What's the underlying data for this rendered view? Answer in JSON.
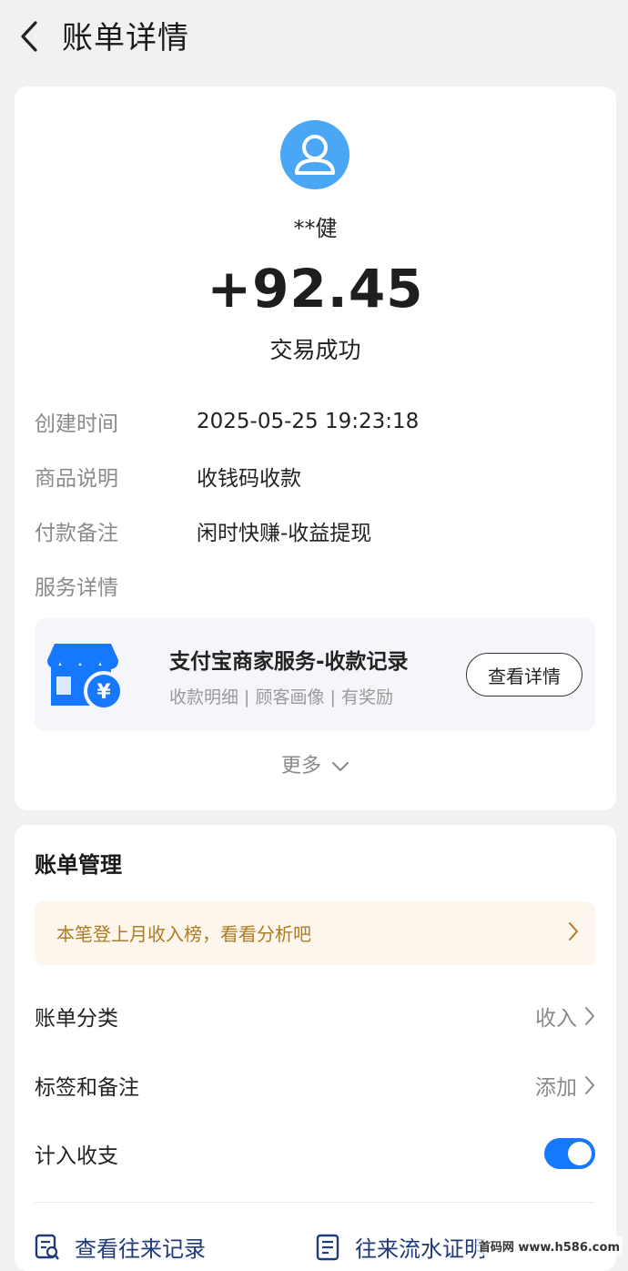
{
  "header": {
    "title": "账单详情",
    "back_icon": "chevron-left-icon"
  },
  "transaction": {
    "payer_name": "**健",
    "amount": "+92.45",
    "status": "交易成功",
    "avatar_color": "#4aa7f5"
  },
  "details": [
    {
      "label": "创建时间",
      "value": "2025-05-25 19:23:18"
    },
    {
      "label": "商品说明",
      "value": "收钱码收款"
    },
    {
      "label": "付款备注",
      "value": "闲时快赚-收益提现"
    },
    {
      "label": "服务详情",
      "value": ""
    }
  ],
  "service": {
    "title": "支付宝商家服务-收款记录",
    "subtitle": "收款明细 | 顾客画像 | 有奖励",
    "button_label": "查看详情",
    "icon": "shop-yuan-icon",
    "icon_color": "#1677ff"
  },
  "more_label": "更多",
  "management": {
    "title": "账单管理",
    "banner_text": "本笔登上月收入榜，看看分析吧",
    "rows": [
      {
        "label": "账单分类",
        "value": "收入"
      },
      {
        "label": "标签和备注",
        "value": "添加"
      },
      {
        "label": "计入收支",
        "toggle_on": true
      }
    ],
    "links": [
      {
        "label": "查看往来记录",
        "icon": "record-icon"
      },
      {
        "label": "往来流水证明",
        "icon": "certificate-icon"
      }
    ]
  },
  "watermark": "首码网 www.h586.com",
  "colors": {
    "accent": "#1677ff",
    "banner_text": "#b07c23",
    "link": "#1e3a7a"
  }
}
